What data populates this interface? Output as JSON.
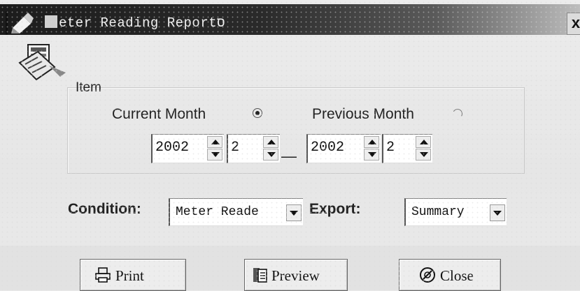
{
  "window": {
    "title": "eter Reading Report",
    "title_suffix": "ס",
    "close_label": "x"
  },
  "item_group": {
    "label": "Item",
    "current_month_label": "Current Month",
    "current_month_selected": true,
    "previous_month_label": "Previous Month",
    "previous_month_selected": false,
    "range_separator": "—",
    "from_year": "2002",
    "from_month": "2",
    "to_year": "2002",
    "to_month": "2"
  },
  "condition": {
    "label": "Condition:",
    "value": "Meter Reade"
  },
  "export": {
    "label": "Export:",
    "value": "Summary"
  },
  "buttons": {
    "print": "Print",
    "preview": "Preview",
    "close": "Close"
  },
  "icons": {
    "app": "pen-icon",
    "report": "report-icon",
    "print": "printer-icon",
    "preview": "preview-icon",
    "close": "close-circle-icon"
  }
}
